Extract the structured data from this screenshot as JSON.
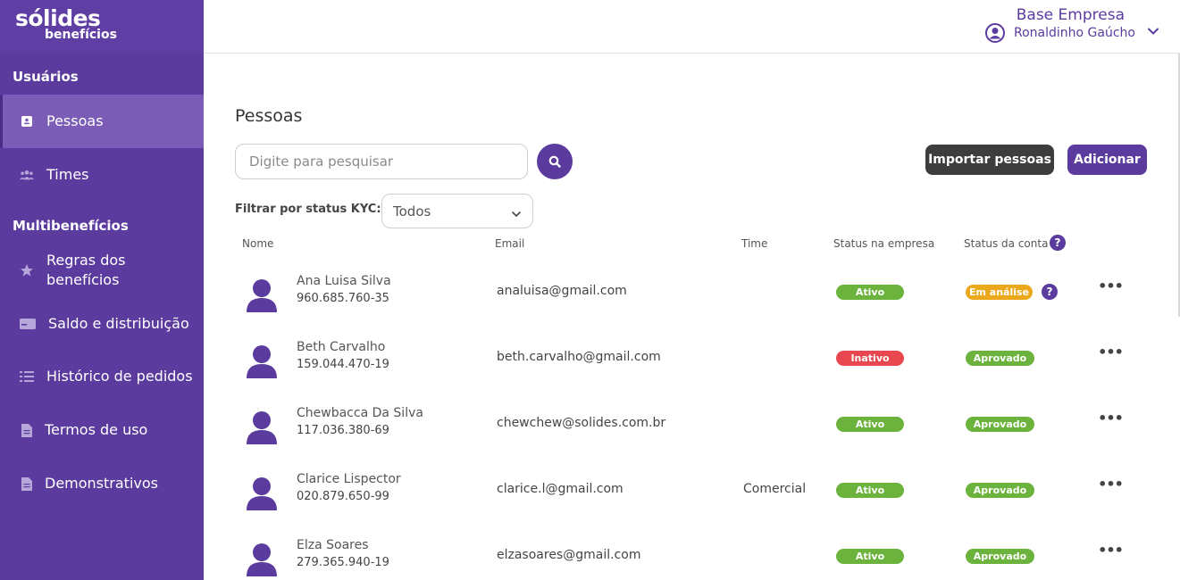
{
  "brand": {
    "logo_main": "sólides",
    "logo_sub": "benefícios"
  },
  "header": {
    "company": "Base Empresa",
    "user_name": "Ronaldinho Gaúcho"
  },
  "sidebar": {
    "section_users": "Usuários",
    "section_benefits": "Multibenefícios",
    "items": [
      {
        "label": "Pessoas",
        "icon": "contact-card-icon",
        "active": true
      },
      {
        "label": "Times",
        "icon": "team-icon",
        "active": false
      },
      {
        "label": "Regras dos benefícios",
        "icon": "star-icon",
        "active": false
      },
      {
        "label": "Saldo e distribuição",
        "icon": "card-icon",
        "active": false
      },
      {
        "label": "Histórico de pedidos",
        "icon": "list-icon",
        "active": false
      },
      {
        "label": "Termos de uso",
        "icon": "document-icon",
        "active": false
      },
      {
        "label": "Demonstrativos",
        "icon": "document-icon",
        "active": false
      }
    ]
  },
  "main": {
    "title": "Pessoas",
    "search": {
      "placeholder": "Digite para pesquisar",
      "value": ""
    },
    "import_label": "Importar pessoas",
    "add_label": "Adicionar",
    "filter": {
      "label": "Filtrar por status KYC:",
      "value": "Todos"
    }
  },
  "table": {
    "columns": {
      "name": "Nome",
      "email": "Email",
      "time": "Time",
      "company_status": "Status na empresa",
      "account_status": "Status da conta",
      "help": "?"
    },
    "rows": [
      {
        "name": "Ana Luisa Silva",
        "cpf": "960.685.760-35",
        "email": "analuisa@gmail.com",
        "time": "",
        "company_status": "Ativo",
        "account_status": "Em análise",
        "account_help": "?"
      },
      {
        "name": "Beth Carvalho",
        "cpf": "159.044.470-19",
        "email": "beth.carvalho@gmail.com",
        "time": "",
        "company_status": "Inativo",
        "account_status": "Aprovado",
        "account_help": ""
      },
      {
        "name": "Chewbacca Da Silva",
        "cpf": "117.036.380-69",
        "email": "chewchew@solides.com.br",
        "time": "",
        "company_status": "Ativo",
        "account_status": "Aprovado",
        "account_help": ""
      },
      {
        "name": "Clarice Lispector",
        "cpf": "020.879.650-99",
        "email": "clarice.l@gmail.com",
        "time": "Comercial",
        "company_status": "Ativo",
        "account_status": "Aprovado",
        "account_help": ""
      },
      {
        "name": "Elza Soares",
        "cpf": "279.365.940-19",
        "email": "elzasoares@gmail.com",
        "time": "",
        "company_status": "Ativo",
        "account_status": "Aprovado",
        "account_help": ""
      }
    ]
  },
  "colors": {
    "primary": "#5b3b9e",
    "active": "#6bb33c",
    "inactive": "#e8474f",
    "in_review": "#eba81a",
    "approved": "#6bb33c"
  }
}
